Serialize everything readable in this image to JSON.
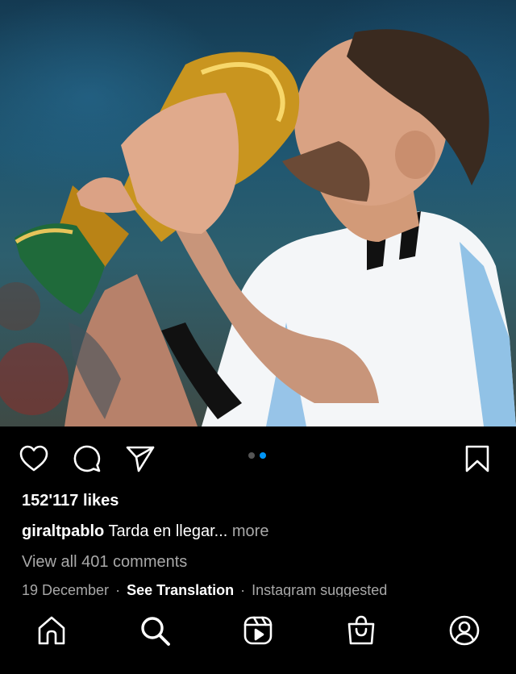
{
  "post": {
    "image_alt": "Player kissing a golden trophy",
    "carousel": {
      "total": 2,
      "active": 2
    }
  },
  "likes": "152'117 likes",
  "caption": {
    "user": "giraltpablo",
    "text": "Tarda en llegar...",
    "more": "more"
  },
  "comments_link": "View all 401 comments",
  "meta": {
    "date": "19 December",
    "separator": "·",
    "translate": "See Translation",
    "suggested": "Instagram suggested"
  },
  "icons": {
    "like": "heart-icon",
    "comment": "comment-icon",
    "share": "send-icon",
    "save": "bookmark-icon"
  },
  "nav": [
    {
      "name": "home",
      "icon": "home-icon"
    },
    {
      "name": "search",
      "icon": "search-icon"
    },
    {
      "name": "reels",
      "icon": "reels-icon"
    },
    {
      "name": "shop",
      "icon": "shop-icon"
    },
    {
      "name": "profile",
      "icon": "profile-icon"
    }
  ],
  "colors": {
    "background": "#000000",
    "muted_text": "#a8a8a8",
    "active_dot": "#0095f6",
    "inactive_dot": "#555555"
  }
}
